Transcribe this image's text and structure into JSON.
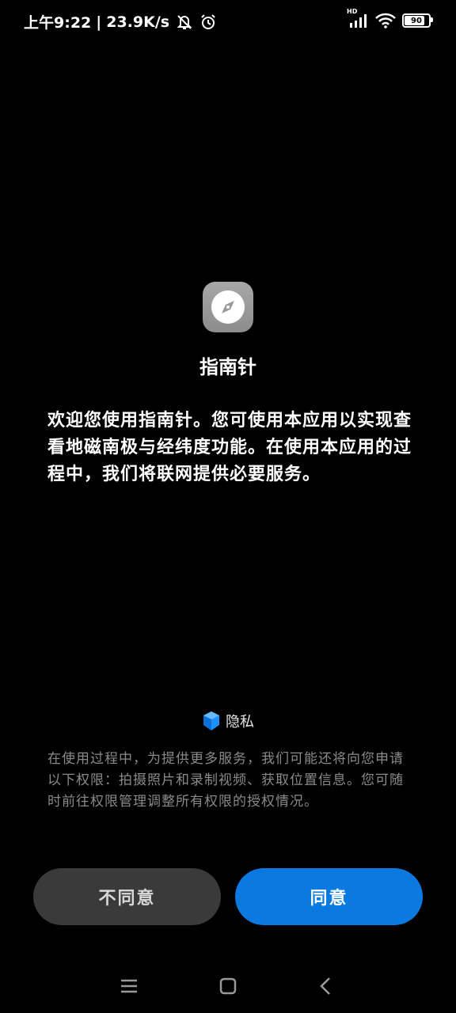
{
  "status_bar": {
    "time": "上午9:22",
    "separator": "|",
    "network_speed": "23.9K/s",
    "icons": [
      "mute-vibrate-icon",
      "alarm-icon",
      "hd-signal-icon",
      "wifi-icon",
      "battery-icon"
    ],
    "signal_label": "HD",
    "battery_level": "90",
    "battery_fraction": 0.9
  },
  "app": {
    "icon": "compass-icon",
    "icon_color": "#9a9a9a",
    "title": "指南针",
    "welcome_text": "欢迎您使用指南针。您可使用本应用以实现查看地磁南极与经纬度功能。在使用本应用的过程中，我们将联网提供必要服务。"
  },
  "privacy": {
    "icon": "privacy-shield-icon",
    "label": "隐私",
    "permission_text": "在使用过程中，为提供更多服务，我们可能还将向您申请以下权限：拍摄照片和录制视频、获取位置信息。您可随时前往权限管理调整所有权限的授权情况。"
  },
  "buttons": {
    "disagree_label": "不同意",
    "agree_label": "同意",
    "agree_color": "#0a7ae0",
    "disagree_color": "#3a3a3a"
  },
  "nav_bar": {
    "icons": [
      "menu-icon",
      "home-icon",
      "back-icon"
    ]
  }
}
